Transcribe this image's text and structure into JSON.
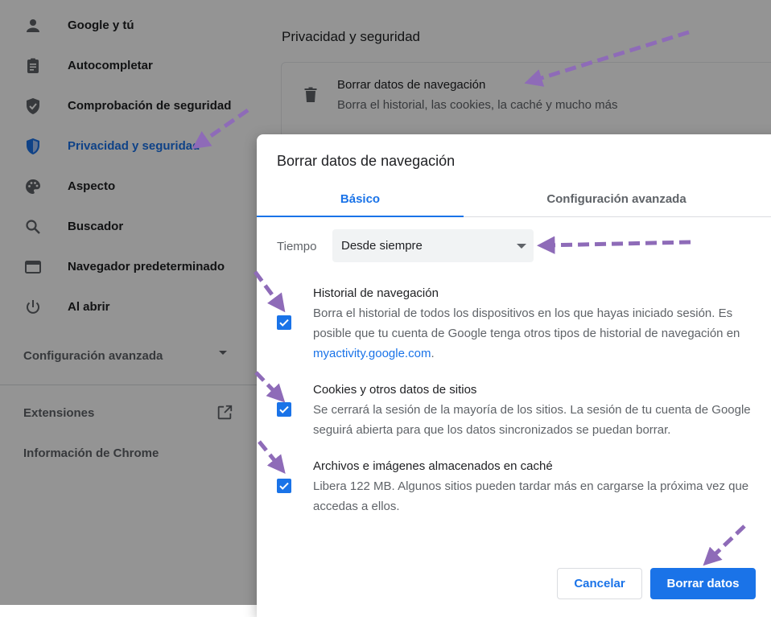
{
  "sidebar": {
    "items": [
      {
        "label": "Google y tú",
        "icon": "person-icon"
      },
      {
        "label": "Autocompletar",
        "icon": "clipboard-icon"
      },
      {
        "label": "Comprobación de seguridad",
        "icon": "shield-check-icon"
      },
      {
        "label": "Privacidad y seguridad",
        "icon": "shield-icon"
      },
      {
        "label": "Aspecto",
        "icon": "palette-icon"
      },
      {
        "label": "Buscador",
        "icon": "search-icon"
      },
      {
        "label": "Navegador predeterminado",
        "icon": "browser-window-icon"
      },
      {
        "label": "Al abrir",
        "icon": "power-icon"
      }
    ],
    "advanced_label": "Configuración avanzada",
    "extensions_label": "Extensiones",
    "about_label": "Información de Chrome"
  },
  "main": {
    "section_title": "Privacidad y seguridad",
    "card_title": "Borrar datos de navegación",
    "card_subtitle": "Borra el historial, las cookies, la caché y mucho más"
  },
  "dialog": {
    "title": "Borrar datos de navegación",
    "tabs": [
      {
        "label": "Básico",
        "selected": true
      },
      {
        "label": "Configuración avanzada",
        "selected": false
      }
    ],
    "time_label": "Tiempo",
    "time_value": "Desde siempre",
    "options": [
      {
        "title": "Historial de navegación",
        "desc_before_link": "Borra el historial de todos los dispositivos en los que hayas iniciado sesión. Es posible que tu cuenta de Google tenga otros tipos de historial de navegación en ",
        "link": "myactivity.google.com",
        "desc_after_link": ".",
        "checked": true
      },
      {
        "title": "Cookies y otros datos de sitios",
        "desc": "Se cerrará la sesión de la mayoría de los sitios. La sesión de tu cuenta de Google seguirá abierta para que los datos sincronizados se puedan borrar.",
        "checked": true
      },
      {
        "title": "Archivos e imágenes almacenados en caché",
        "desc": "Libera 122 MB. Algunos sitios pueden tardar más en cargarse la próxima vez que accedas a ellos.",
        "checked": true
      }
    ],
    "cancel_label": "Cancelar",
    "confirm_label": "Borrar datos"
  },
  "colors": {
    "accent": "#1a73e8",
    "annotation_arrow": "#8e6bb8"
  }
}
